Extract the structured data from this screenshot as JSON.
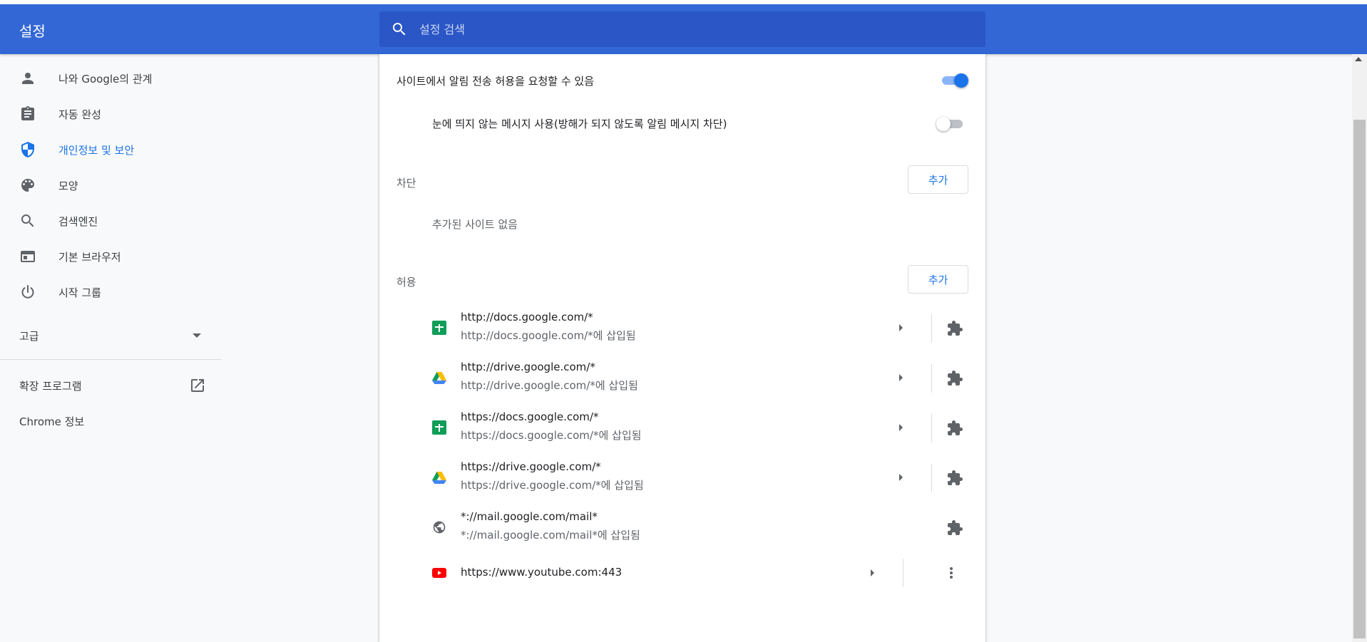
{
  "header": {
    "title": "설정",
    "search_placeholder": "설정 검색"
  },
  "colors": {
    "header": "#3367d6",
    "search": "#2a56c6",
    "accent": "#1a73e8",
    "sheets": "#0f9d58",
    "youtube": "#ff0000"
  },
  "sidebar": {
    "items": [
      {
        "label": "나와 Google의 관계",
        "icon": "person-icon"
      },
      {
        "label": "자동 완성",
        "icon": "clipboard-icon"
      },
      {
        "label": "개인정보 및 보안",
        "icon": "shield-icon",
        "active": true
      },
      {
        "label": "모양",
        "icon": "palette-icon"
      },
      {
        "label": "검색엔진",
        "icon": "search-icon"
      },
      {
        "label": "기본 브라우저",
        "icon": "browser-icon"
      },
      {
        "label": "시작 그룹",
        "icon": "power-icon"
      }
    ],
    "advanced": "고급",
    "extensions": "확장 프로그램",
    "about": "Chrome 정보"
  },
  "main": {
    "ask_permission": {
      "label": "사이트에서 알림 전송 허용을 요청할 수 있음",
      "enabled": true
    },
    "quiet_messaging": {
      "label": "눈에 띄지 않는 메시지 사용(방해가 되지 않도록 알림 메시지 차단)",
      "enabled": false
    },
    "block": {
      "label": "차단",
      "add": "추가",
      "empty": "추가된 사이트 없음"
    },
    "allow": {
      "label": "허용",
      "add": "추가",
      "sites": [
        {
          "url": "http://docs.google.com/*",
          "sub": "http://docs.google.com/*에 삽입됨",
          "icon": "sheets-icon"
        },
        {
          "url": "http://drive.google.com/*",
          "sub": "http://drive.google.com/*에 삽입됨",
          "icon": "drive-icon"
        },
        {
          "url": "https://docs.google.com/*",
          "sub": "https://docs.google.com/*에 삽입됨",
          "icon": "sheets-icon"
        },
        {
          "url": "https://drive.google.com/*",
          "sub": "https://drive.google.com/*에 삽입됨",
          "icon": "drive-icon"
        },
        {
          "url": "*://mail.google.com/mail*",
          "sub": "*://mail.google.com/mail*에 삽입됨",
          "icon": "globe-icon"
        },
        {
          "url": "https://www.youtube.com:443",
          "icon": "youtube-icon"
        }
      ]
    }
  }
}
